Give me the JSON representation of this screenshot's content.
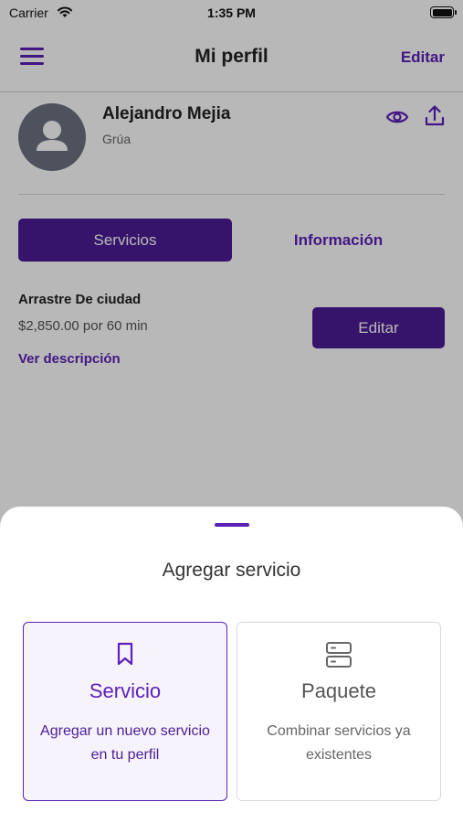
{
  "status_bar": {
    "carrier": "Carrier",
    "time": "1:35 PM"
  },
  "nav": {
    "title": "Mi perfil",
    "edit_label": "Editar"
  },
  "profile": {
    "name": "Alejandro Mejia",
    "role": "Grúa"
  },
  "tabs": [
    {
      "label": "Servicios",
      "active": true
    },
    {
      "label": "Información",
      "active": false
    }
  ],
  "services": [
    {
      "name": "Arrastre De ciudad",
      "price": "$2,850.00 por 60 min",
      "description_link": "Ver descripción",
      "edit_label": "Editar"
    }
  ],
  "sheet": {
    "title": "Agregar servicio",
    "options": [
      {
        "title": "Servicio",
        "description": "Agregar un nuevo servicio en tu perfil",
        "icon": "bookmark-icon",
        "selected": true
      },
      {
        "title": "Paquete",
        "description": "Combinar servicios ya existentes",
        "icon": "server-stack-icon",
        "selected": false
      }
    ]
  },
  "colors": {
    "accent": "#5b21b6",
    "accent_dark": "#4c1d95",
    "selected_card_bg": "#f7f3fc",
    "avatar_bg": "#6b7280"
  }
}
